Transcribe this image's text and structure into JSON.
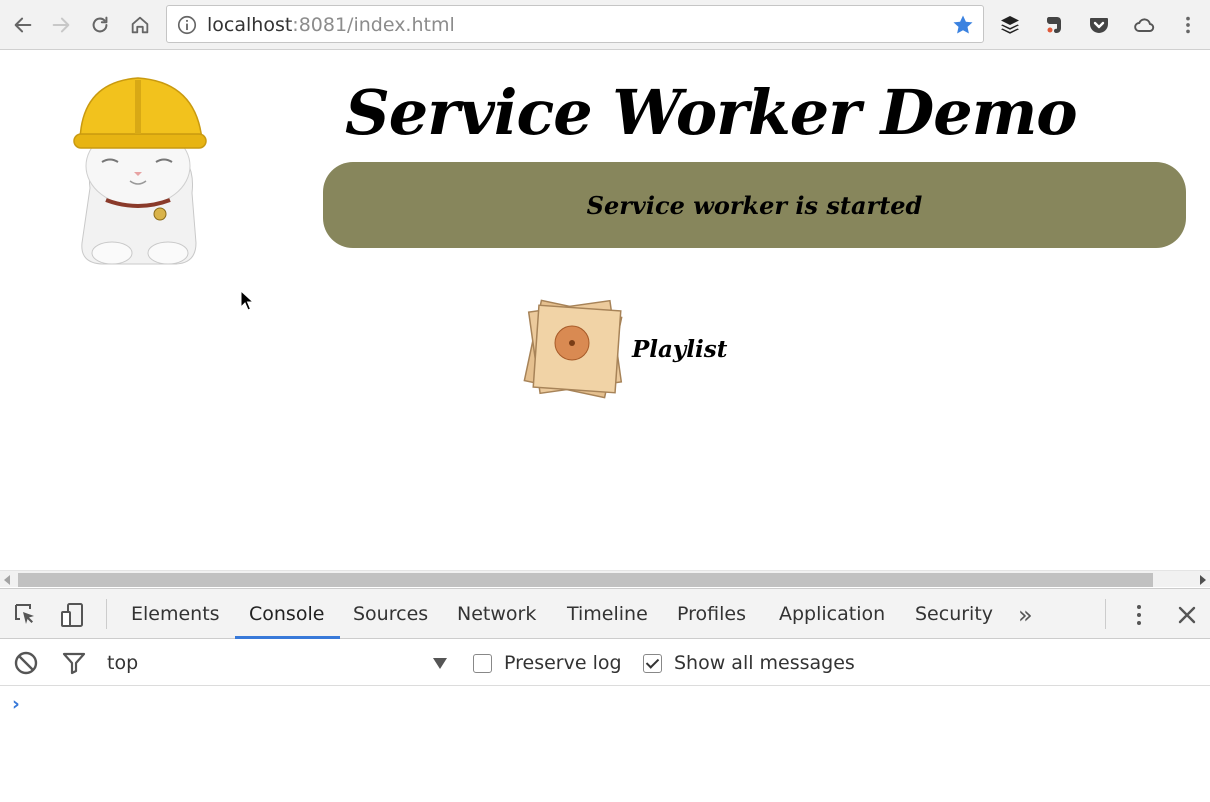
{
  "browser": {
    "url_host": "localhost",
    "url_rest": ":8081/index.html",
    "accent_color": "#3b82e0",
    "nav_icons": [
      "back-icon",
      "forward-icon",
      "reload-icon",
      "home-icon"
    ],
    "extension_icons": [
      "buffer-icon",
      "evernote-icon",
      "pocket-icon",
      "cloud-icon",
      "menu-dots-icon"
    ]
  },
  "page": {
    "title": "Service Worker Demo",
    "status": "Service worker is started",
    "status_bg_color": "#87865c",
    "playlist_label": "Playlist"
  },
  "devtools": {
    "tabs": [
      "Elements",
      "Console",
      "Sources",
      "Network",
      "Timeline",
      "Profiles",
      "Application",
      "Security"
    ],
    "active_tab": "Console",
    "more_tabs": "»",
    "context": "top",
    "preserve_log": {
      "label": "Preserve log",
      "checked": false
    },
    "show_all": {
      "label": "Show all messages",
      "checked": true
    },
    "prompt": "›",
    "accent_color": "#3879d9"
  }
}
